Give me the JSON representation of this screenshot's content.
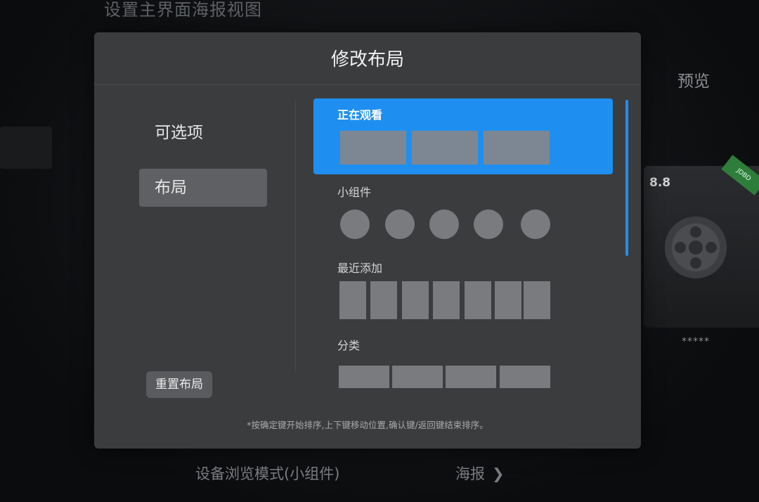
{
  "background": {
    "title": "设置主界面海报视图",
    "preview_label": "预览",
    "rating": "8.8",
    "stars": "*****",
    "bottom_mode": "设备浏览模式(小组件)",
    "bottom_poster": "海报",
    "badge_text": "JDBD"
  },
  "dialog": {
    "title": "修改布局",
    "nav": [
      {
        "label": "可选项",
        "selected": false
      },
      {
        "label": "布局",
        "selected": true
      }
    ],
    "reset_label": "重置布局",
    "hint": "*按确定键开始排序,上下键移动位置,确认键/返回键结束排序。",
    "sections": [
      {
        "label": "正在观看",
        "focused": true
      },
      {
        "label": "小组件",
        "focused": false
      },
      {
        "label": "最近添加",
        "focused": false
      },
      {
        "label": "分类",
        "focused": false
      }
    ]
  },
  "colors": {
    "accent": "#1e8ff0",
    "dialog_bg": "#3b3c3e",
    "placeholder": "#7a7b7e"
  },
  "icons": {
    "chevron": "chevron-right-icon",
    "reel": "film-reel-icon"
  }
}
